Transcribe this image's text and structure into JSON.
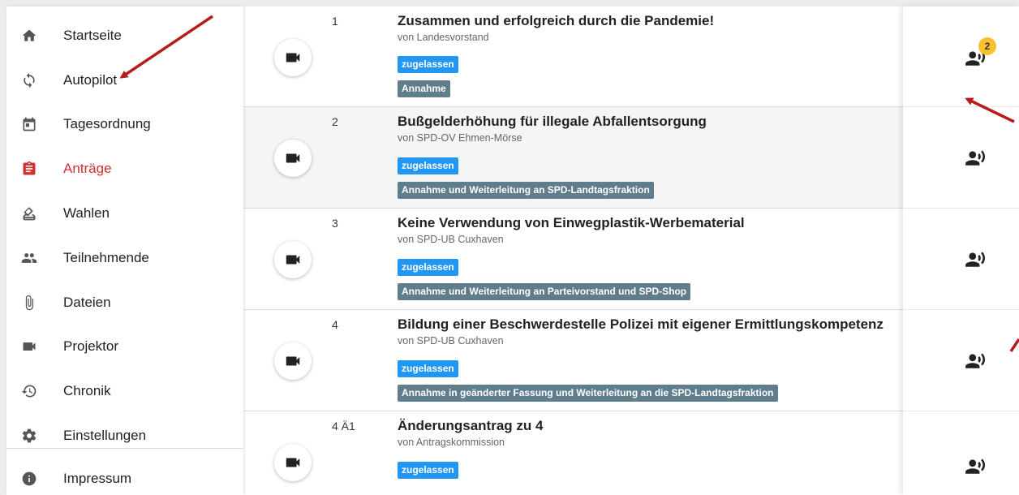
{
  "sidebar": {
    "items": [
      {
        "label": "Startseite",
        "icon": "home-icon"
      },
      {
        "label": "Autopilot",
        "icon": "sync-icon"
      },
      {
        "label": "Tagesordnung",
        "icon": "calendar-icon"
      },
      {
        "label": "Anträge",
        "icon": "assignment-icon",
        "active": true
      },
      {
        "label": "Wahlen",
        "icon": "ballot-icon"
      },
      {
        "label": "Teilnehmende",
        "icon": "people-icon"
      },
      {
        "label": "Dateien",
        "icon": "attachment-icon"
      },
      {
        "label": "Projektor",
        "icon": "videocam-icon"
      },
      {
        "label": "Chronik",
        "icon": "history-icon"
      },
      {
        "label": "Einstellungen",
        "icon": "settings-icon"
      },
      {
        "label": "Impressum",
        "icon": "info-icon"
      }
    ],
    "active_color": "#d32f2f"
  },
  "motions": [
    {
      "number": "1",
      "title": "Zusammen und erfolgreich durch die Pandemie!",
      "submitter": "von Landesvorstand",
      "state": "zugelassen",
      "recommendation": "Annahme",
      "speaker_count": "2"
    },
    {
      "number": "2",
      "title": "Bußgelderhöhung für illegale Abfallentsorgung",
      "submitter": "von SPD-OV Ehmen-Mörse",
      "state": "zugelassen",
      "recommendation": "Annahme und Weiterleitung an SPD-Landtagsfraktion"
    },
    {
      "number": "3",
      "title": "Keine Verwendung von Einwegplastik-Werbematerial",
      "submitter": "von SPD-UB Cuxhaven",
      "state": "zugelassen",
      "recommendation": "Annahme und Weiterleitung an Parteivorstand und SPD-Shop"
    },
    {
      "number": "4",
      "title": "Bildung einer Beschwerdestelle Polizei mit eigener Ermittlungskompetenz",
      "submitter": "von SPD-UB Cuxhaven",
      "state": "zugelassen",
      "recommendation": "Annahme in geänderter Fassung und Weiterleitung an die SPD-Landtagsfraktion"
    },
    {
      "number": "4 Ä1",
      "title": "Änderungsantrag zu 4",
      "submitter": "von Antragskommission",
      "state": "zugelassen"
    }
  ],
  "colors": {
    "state_badge": "#2196f3",
    "recommendation_badge": "#607d8b",
    "speaker_count_badge": "#fbc02d",
    "annotation_arrow": "#b71c1c"
  }
}
